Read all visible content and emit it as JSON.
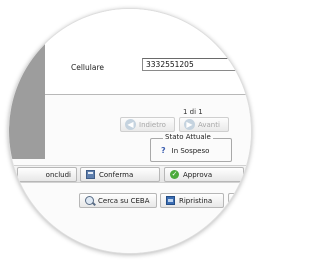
{
  "form": {
    "cellulare_label": "Cellulare",
    "cellulare_value": "3332551205"
  },
  "pagination": {
    "page_text": "1 di 1",
    "prev_label": "Indietro",
    "next_label": "Avanti"
  },
  "status": {
    "legend": "Stato Attuale",
    "value": "In Sospeso",
    "help_glyph": "?"
  },
  "actions": {
    "concludi_label": "oncludi",
    "conferma_label": "Conferma",
    "approva_label": "Approva",
    "cerca_label": "Cerca su CEBA",
    "ripristina_label": "Ripristina"
  },
  "icons": {
    "prev": "arrow-left-icon",
    "next": "arrow-right-icon",
    "help": "question-icon",
    "conferma": "floppy-disk-icon",
    "approva": "check-circle-icon",
    "cerca": "magnifier-icon",
    "ripristina": "restore-icon"
  },
  "colors": {
    "side_panel": "#9d9d9d",
    "status_help": "#3d5fb0",
    "approve_green": "#4caa3c"
  }
}
